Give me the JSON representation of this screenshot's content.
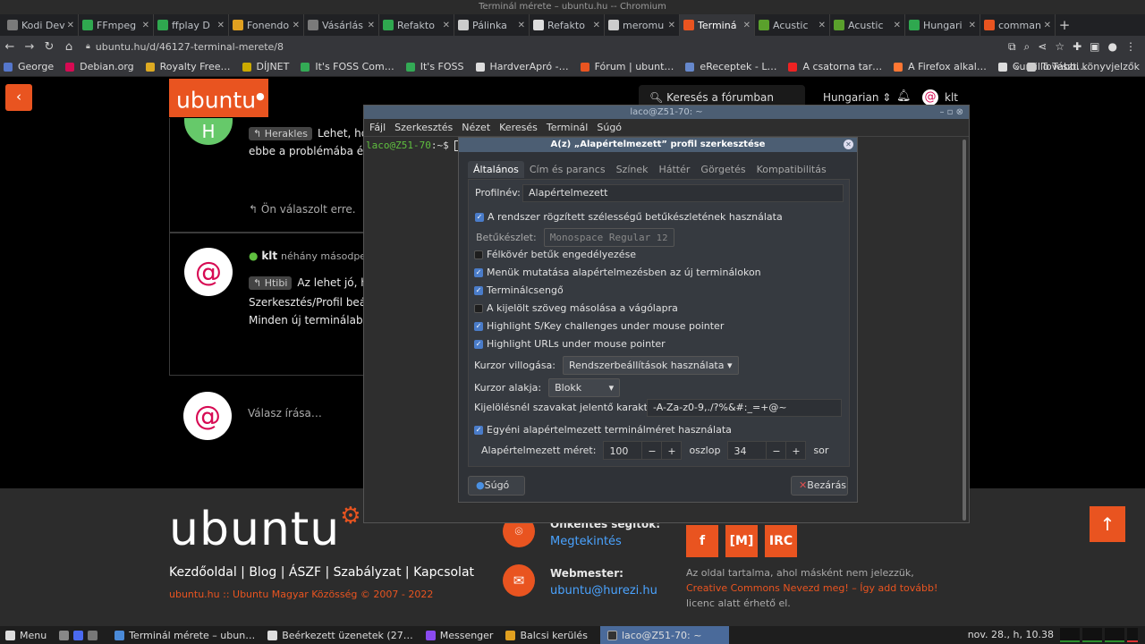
{
  "window_title": "Terminál mérete – ubuntu.hu -- Chromium",
  "tabs": [
    {
      "label": "Kodi Dev",
      "color": "#7a7a7a",
      "active": false
    },
    {
      "label": "FFmpeg",
      "color": "#2fa84f",
      "active": false
    },
    {
      "label": "ffplay D",
      "color": "#2fa84f",
      "active": false
    },
    {
      "label": "Fonendo",
      "color": "#e0a020",
      "active": false
    },
    {
      "label": "Vásárlás",
      "color": "#7a7a7a",
      "active": false
    },
    {
      "label": "Refakto",
      "color": "#2fa84f",
      "active": false
    },
    {
      "label": "Pálinka",
      "color": "#cccccc",
      "active": false
    },
    {
      "label": "Refakto",
      "color": "#dddddd",
      "active": false
    },
    {
      "label": "meromu",
      "color": "#cccccc",
      "active": false
    },
    {
      "label": "Terminá",
      "color": "#e95420",
      "active": true
    },
    {
      "label": "Acustic",
      "color": "#5aa02c",
      "active": false
    },
    {
      "label": "Acustic",
      "color": "#5aa02c",
      "active": false
    },
    {
      "label": "Hungari",
      "color": "#2fa84f",
      "active": false
    },
    {
      "label": "comman",
      "color": "#e95420",
      "active": false
    }
  ],
  "url": "ubuntu.hu/d/46127-terminal-merete/8",
  "bookmarks": [
    {
      "label": "George",
      "color": "#5577cc"
    },
    {
      "label": "Debian.org",
      "color": "#d70a53"
    },
    {
      "label": "Royalty Free…",
      "color": "#ddaa22"
    },
    {
      "label": "DÍJNET",
      "color": "#ccaa00"
    },
    {
      "label": "It's FOSS Com…",
      "color": "#33aa55"
    },
    {
      "label": "It's FOSS",
      "color": "#33aa55"
    },
    {
      "label": "HardverApró -…",
      "color": "#dddddd"
    },
    {
      "label": "Fórum | ubunt…",
      "color": "#e95420"
    },
    {
      "label": "eReceptek - L…",
      "color": "#6688cc"
    },
    {
      "label": "A csatorna tar…",
      "color": "#ee2222"
    },
    {
      "label": "A Firefox alkal…",
      "color": "#ff7733"
    },
    {
      "label": "Cursillo Teszt…",
      "color": "#dddddd"
    }
  ],
  "bookmarks_more": "»",
  "bookmarks_folder": "További könyvjelzők",
  "site": {
    "logo": "ubuntu",
    "search": "Keresés a fórumban",
    "language": "Hungarian",
    "user": "klt"
  },
  "posts": {
    "p1": {
      "avatar": "H",
      "quote": "Herakles",
      "text1": "Lehet, ho",
      "text2": "ebbe a problémába és ez",
      "replied": "Ön válaszolt erre."
    },
    "p2": {
      "author": "klt",
      "time": "néhány másodperc",
      "quote": "Htibi",
      "text1": "Az lehet jó, ho",
      "text2": "Szerkesztés/Profil beállít",
      "text3": "Minden új terminálablak"
    },
    "reply": "Válasz írása…"
  },
  "footer": {
    "logo": "ubuntu",
    "links": "Kezdőoldal | Blog | ÁSZF | Szabályzat | Kapcsolat",
    "copyright": "ubuntu.hu :: Ubuntu Magyar Közösség © 2007 - 2022",
    "volunteers_title": "Önkéntes segítők:",
    "volunteers_link": "Megtekintés",
    "webmaster_title": "Webmester:",
    "webmaster_email": "ubuntu@hurezi.hu",
    "social": [
      "f",
      "[M]",
      "IRC"
    ],
    "cc1": "Az oldal tartalma, ahol másként nem jelezzük,",
    "cc_link": "Creative Commons Nevezd meg! – Így add tovább!",
    "cc2": "licenc alatt érhető el."
  },
  "terminal": {
    "title": "laco@Z51-70: ~",
    "menu": [
      "Fájl",
      "Szerkesztés",
      "Nézet",
      "Keresés",
      "Terminál",
      "Súgó"
    ],
    "prompt": "laco@Z51-70",
    "prompt_rest": ":~$"
  },
  "dialog": {
    "title": "A(z) „Alapértelmezett” profil szerkesztése",
    "tabs": [
      "Általános",
      "Cím és parancs",
      "Színek",
      "Háttér",
      "Görgetés",
      "Kompatibilitás"
    ],
    "profile_label": "Profilnév:",
    "profile_value": "Alapértelmezett",
    "fixed_font": "A rendszer rögzített szélességű betűkészletének használata",
    "font_label": "Betűkészlet:",
    "font_value": "Monospace Regular",
    "font_size": "12",
    "bold": "Félkövér betűk engedélyezése",
    "menubar": "Menük mutatása alapértelmezésben az új terminálokon",
    "bell": "Terminálcsengő",
    "copy_sel": "A kijelölt szöveg másolása a vágólapra",
    "skey": "Highlight S/Key challenges under mouse pointer",
    "urls": "Highlight URLs under mouse pointer",
    "blink_label": "Kurzor villogása:",
    "blink_value": "Rendszerbeállítások használata",
    "shape_label": "Kurzor alakja:",
    "shape_value": "Blokk",
    "wordchars_label": "Kijelölésnél szavakat jelentő karakterek:",
    "wordchars_value": "-A-Za-z0-9,./?%&#:_=+@~",
    "custom_size": "Egyéni alapértelmezett terminálméret használata",
    "size_label": "Alapértelmezett méret:",
    "cols": "100",
    "cols_unit": "oszlop",
    "rows": "34",
    "rows_unit": "sor",
    "help_btn": "Súgó",
    "close_btn": "Bezárás"
  },
  "taskbar": {
    "menu": "Menu",
    "items": [
      {
        "label": "Terminál mérete – ubun…",
        "color": "#4a8ad8"
      },
      {
        "label": "Beérkezett üzenetek (27…",
        "color": "#dddddd"
      },
      {
        "label": "Messenger",
        "color": "#8a4af0"
      },
      {
        "label": "Balcsi kerülés",
        "color": "#e0a020"
      }
    ],
    "active": "laco@Z51-70: ~",
    "clock": "nov. 28., h, 10.38"
  }
}
